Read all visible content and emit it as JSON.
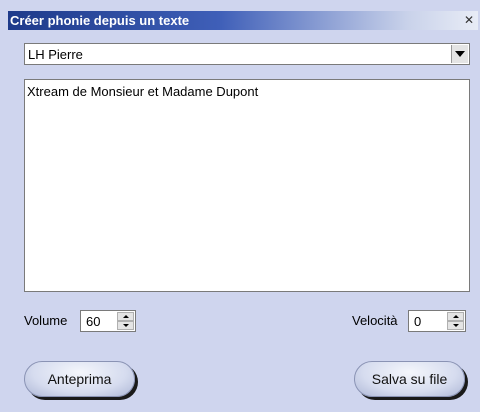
{
  "window": {
    "title": "Créer phonie depuis un texte"
  },
  "voice": {
    "selected": "LH Pierre"
  },
  "text": {
    "content": "Xtream de Monsieur et Madame Dupont"
  },
  "volume": {
    "label": "Volume",
    "value": "60"
  },
  "speed": {
    "label": "Velocità",
    "value": "0"
  },
  "buttons": {
    "preview": "Anteprima",
    "save": "Salva su file"
  },
  "icons": {
    "close": "close-icon",
    "dropdown": "chevron-down-icon"
  }
}
